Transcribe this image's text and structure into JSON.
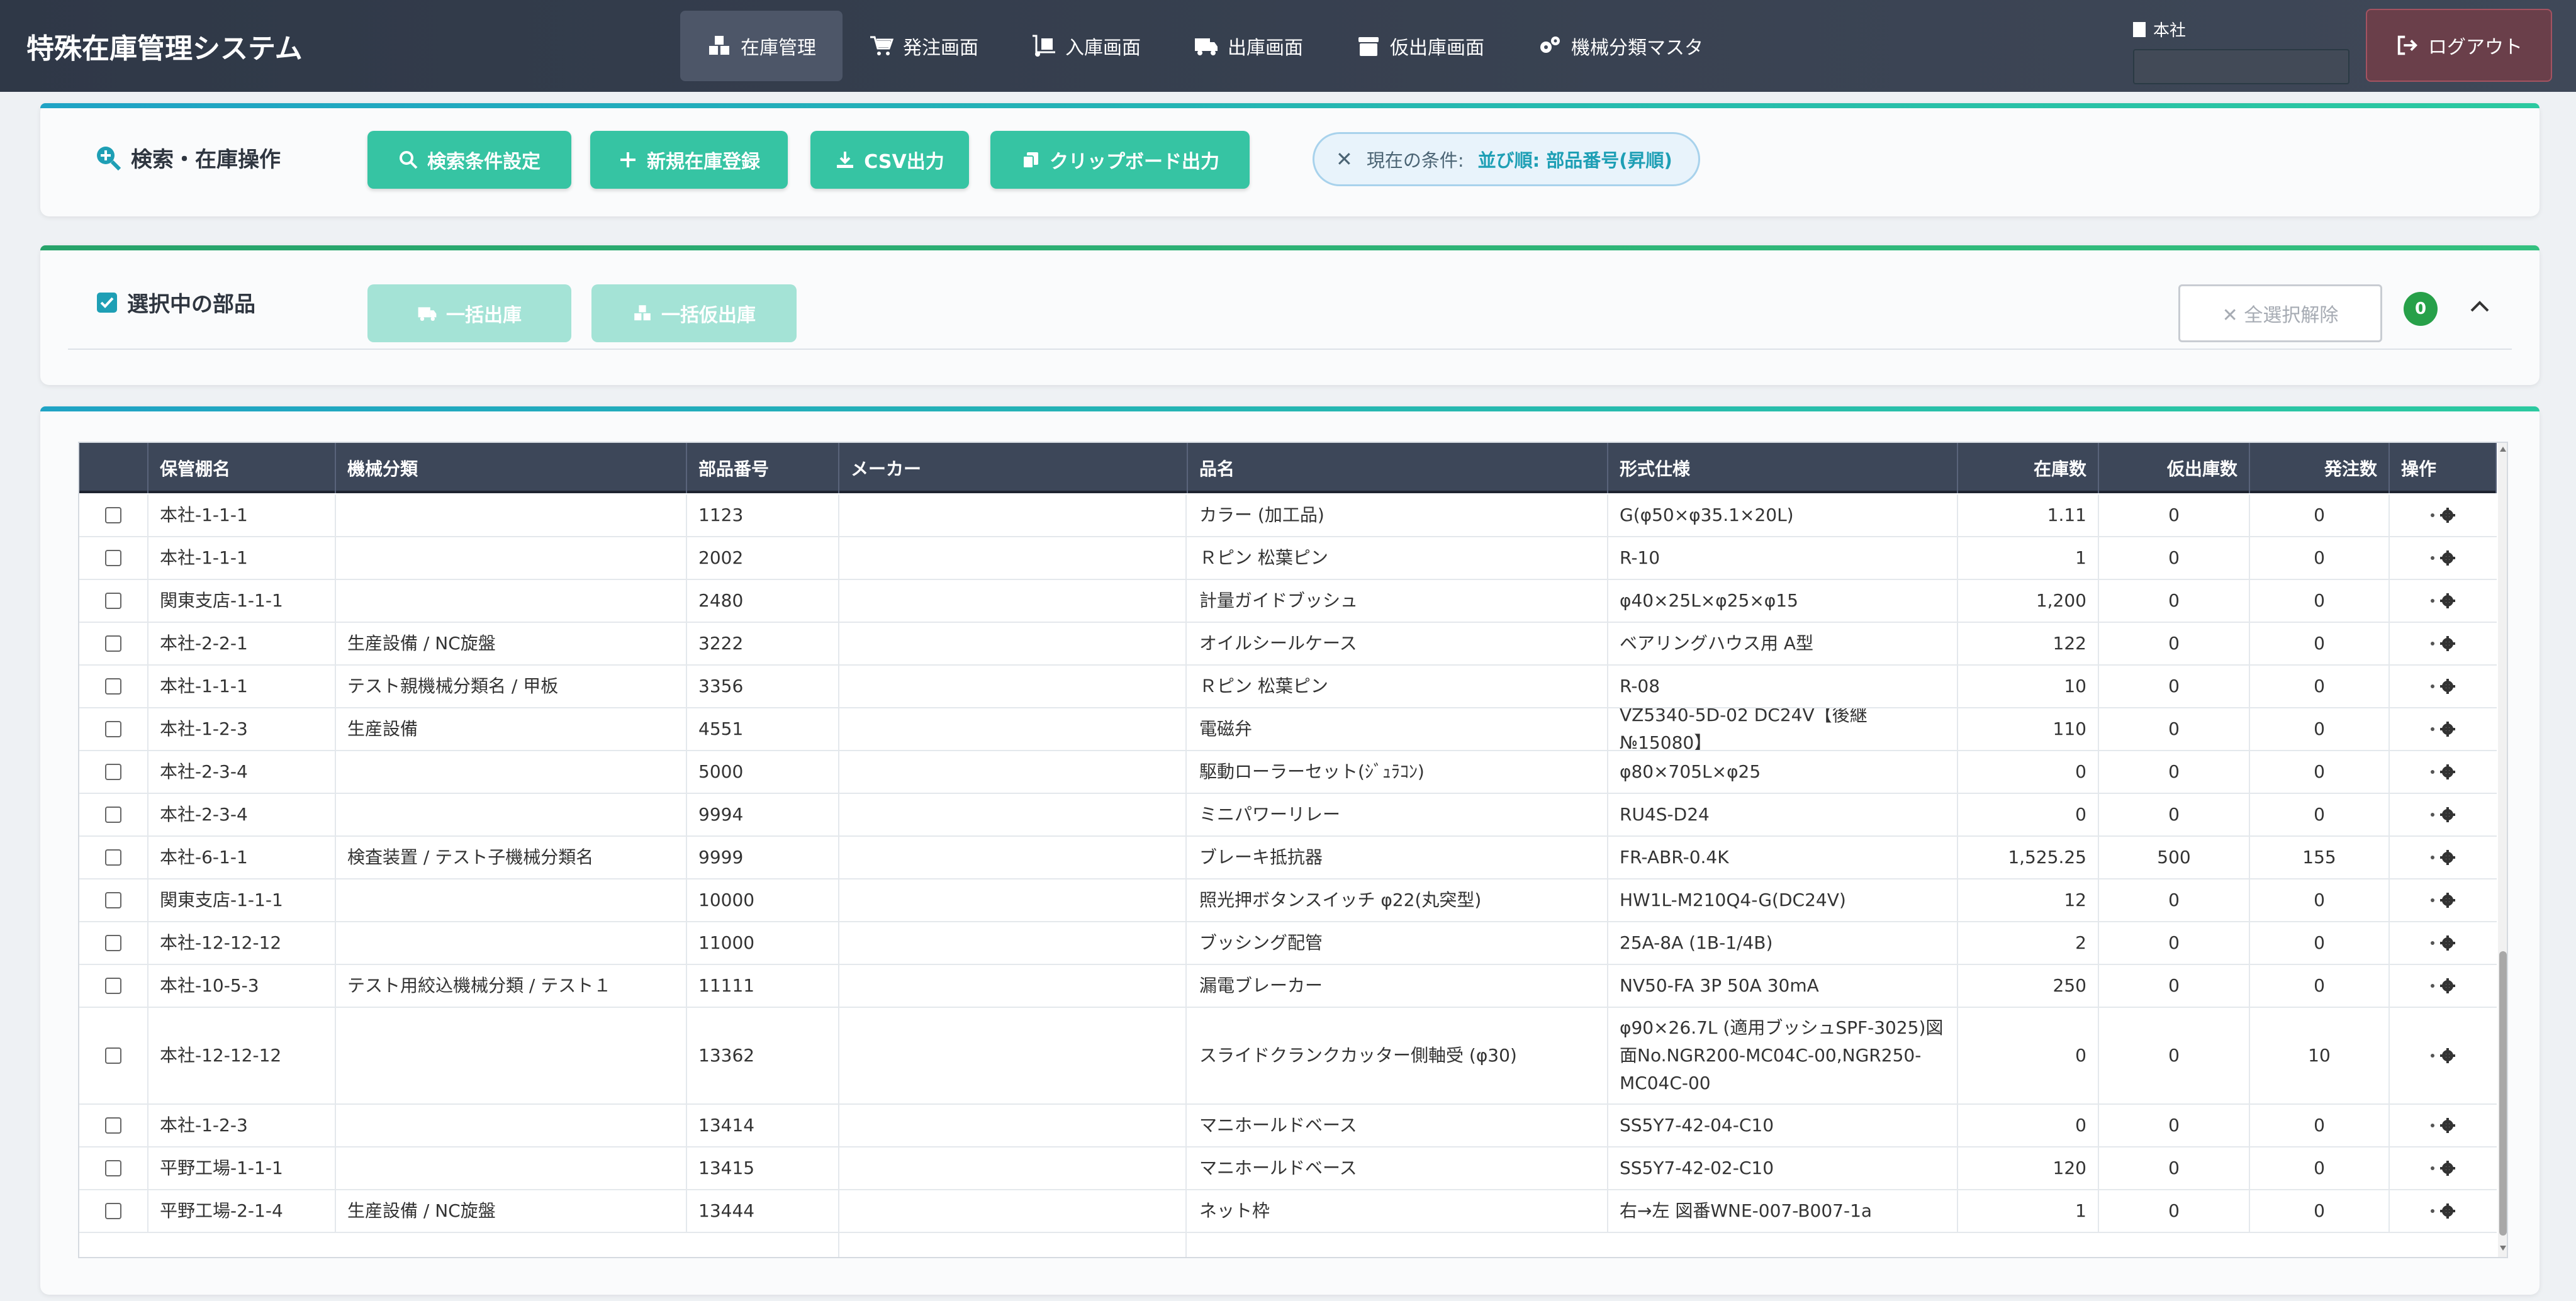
{
  "app_title": "特殊在庫管理システム",
  "nav": {
    "tabs": [
      {
        "label": "在庫管理",
        "icon": "boxes-icon",
        "active": true
      },
      {
        "label": "発注画面",
        "icon": "cart-icon",
        "active": false
      },
      {
        "label": "入庫画面",
        "icon": "dolly-icon",
        "active": false
      },
      {
        "label": "出庫画面",
        "icon": "truck-icon",
        "active": false
      },
      {
        "label": "仮出庫画面",
        "icon": "archive-icon",
        "active": false
      },
      {
        "label": "機械分類マスタ",
        "icon": "gears-icon",
        "active": false
      }
    ],
    "branch_label": "本社",
    "logout_label": "ログアウト"
  },
  "search": {
    "title": "検索・在庫操作",
    "buttons": {
      "settings": "検索条件設定",
      "new": "新規在庫登録",
      "csv": "CSV出力",
      "clipboard": "クリップボード出力"
    },
    "condition_prefix": "現在の条件:",
    "condition_value": "並び順: 部品番号(昇順)"
  },
  "selection": {
    "title": "選択中の部品",
    "bulk_out": "一括出庫",
    "bulk_temp_out": "一括仮出庫",
    "clear_all": "✕ 全選択解除",
    "count": "0"
  },
  "table": {
    "headers": [
      "保管棚名",
      "機械分類",
      "部品番号",
      "メーカー",
      "品名",
      "形式仕様",
      "在庫数",
      "仮出庫数",
      "発注数",
      "操作"
    ],
    "rows": [
      {
        "shelf": "本社-1-1-1",
        "category": "",
        "part_no": "1123",
        "maker": "",
        "name": "カラー (加工品)",
        "spec": "G(φ50×φ35.1×20L)",
        "stock": "1.11",
        "temp_out": "0",
        "order": "0"
      },
      {
        "shelf": "本社-1-1-1",
        "category": "",
        "part_no": "2002",
        "maker": "",
        "name": "Ｒピン 松葉ピン",
        "spec": "R-10",
        "stock": "1",
        "temp_out": "0",
        "order": "0"
      },
      {
        "shelf": "関東支店-1-1-1",
        "category": "",
        "part_no": "2480",
        "maker": "",
        "name": "計量ガイドブッシュ",
        "spec": "φ40×25L×φ25×φ15",
        "stock": "1,200",
        "temp_out": "0",
        "order": "0"
      },
      {
        "shelf": "本社-2-2-1",
        "category": "生産設備 / NC旋盤",
        "part_no": "3222",
        "maker": "",
        "name": "オイルシールケース",
        "spec": "ベアリングハウス用 A型",
        "stock": "122",
        "temp_out": "0",
        "order": "0"
      },
      {
        "shelf": "本社-1-1-1",
        "category": "テスト親機械分類名 / 甲板",
        "part_no": "3356",
        "maker": "",
        "name": "Ｒピン 松葉ピン",
        "spec": "R-08",
        "stock": "10",
        "temp_out": "0",
        "order": "0"
      },
      {
        "shelf": "本社-1-2-3",
        "category": "生産設備",
        "part_no": "4551",
        "maker": "",
        "name": "電磁弁",
        "spec": "VZ5340-5D-02 DC24V【後継№15080】",
        "stock": "110",
        "temp_out": "0",
        "order": "0"
      },
      {
        "shelf": "本社-2-3-4",
        "category": "",
        "part_no": "5000",
        "maker": "",
        "name": "駆動ローラーセット(ｼﾞｭﾗｺﾝ)",
        "spec": "φ80×705L×φ25",
        "stock": "0",
        "temp_out": "0",
        "order": "0"
      },
      {
        "shelf": "本社-2-3-4",
        "category": "",
        "part_no": "9994",
        "maker": "",
        "name": "ミニパワーリレー",
        "spec": "RU4S-D24",
        "stock": "0",
        "temp_out": "0",
        "order": "0"
      },
      {
        "shelf": "本社-6-1-1",
        "category": "検査装置 / テスト子機械分類名",
        "part_no": "9999",
        "maker": "",
        "name": "ブレーキ抵抗器",
        "spec": "FR-ABR-0.4K",
        "stock": "1,525.25",
        "temp_out": "500",
        "order": "155"
      },
      {
        "shelf": "関東支店-1-1-1",
        "category": "",
        "part_no": "10000",
        "maker": "",
        "name": "照光押ボタンスイッチ φ22(丸突型)",
        "spec": "HW1L-M210Q4-G(DC24V)",
        "stock": "12",
        "temp_out": "0",
        "order": "0"
      },
      {
        "shelf": "本社-12-12-12",
        "category": "",
        "part_no": "11000",
        "maker": "",
        "name": "ブッシング配管",
        "spec": "25A-8A (1B-1/4B)",
        "stock": "2",
        "temp_out": "0",
        "order": "0"
      },
      {
        "shelf": "本社-10-5-3",
        "category": "テスト用絞込機械分類 / テスト１",
        "part_no": "11111",
        "maker": "",
        "name": "漏電ブレーカー",
        "spec": "NV50-FA 3P 50A 30mA",
        "stock": "250",
        "temp_out": "0",
        "order": "0"
      },
      {
        "shelf": "本社-12-12-12",
        "category": "",
        "part_no": "13362",
        "maker": "",
        "name": "スライドクランクカッター側軸受 (φ30)",
        "spec": "φ90×26.7L (適用ブッシュSPF-3025)図面No.NGR200-MC04C-00,NGR250-MC04C-00",
        "stock": "0",
        "temp_out": "0",
        "order": "10",
        "tall": true
      },
      {
        "shelf": "本社-1-2-3",
        "category": "",
        "part_no": "13414",
        "maker": "",
        "name": "マニホールドベース",
        "spec": "SS5Y7-42-04-C10",
        "stock": "0",
        "temp_out": "0",
        "order": "0"
      },
      {
        "shelf": "平野工場-1-1-1",
        "category": "",
        "part_no": "13415",
        "maker": "",
        "name": "マニホールドベース",
        "spec": "SS5Y7-42-02-C10",
        "stock": "120",
        "temp_out": "0",
        "order": "0"
      },
      {
        "shelf": "平野工場-2-1-4",
        "category": "生産設備 / NC旋盤",
        "part_no": "13444",
        "maker": "",
        "name": "ネット枠",
        "spec": "右→左 図番WNE-007-B007-1a",
        "stock": "1",
        "temp_out": "0",
        "order": "0"
      }
    ]
  }
}
